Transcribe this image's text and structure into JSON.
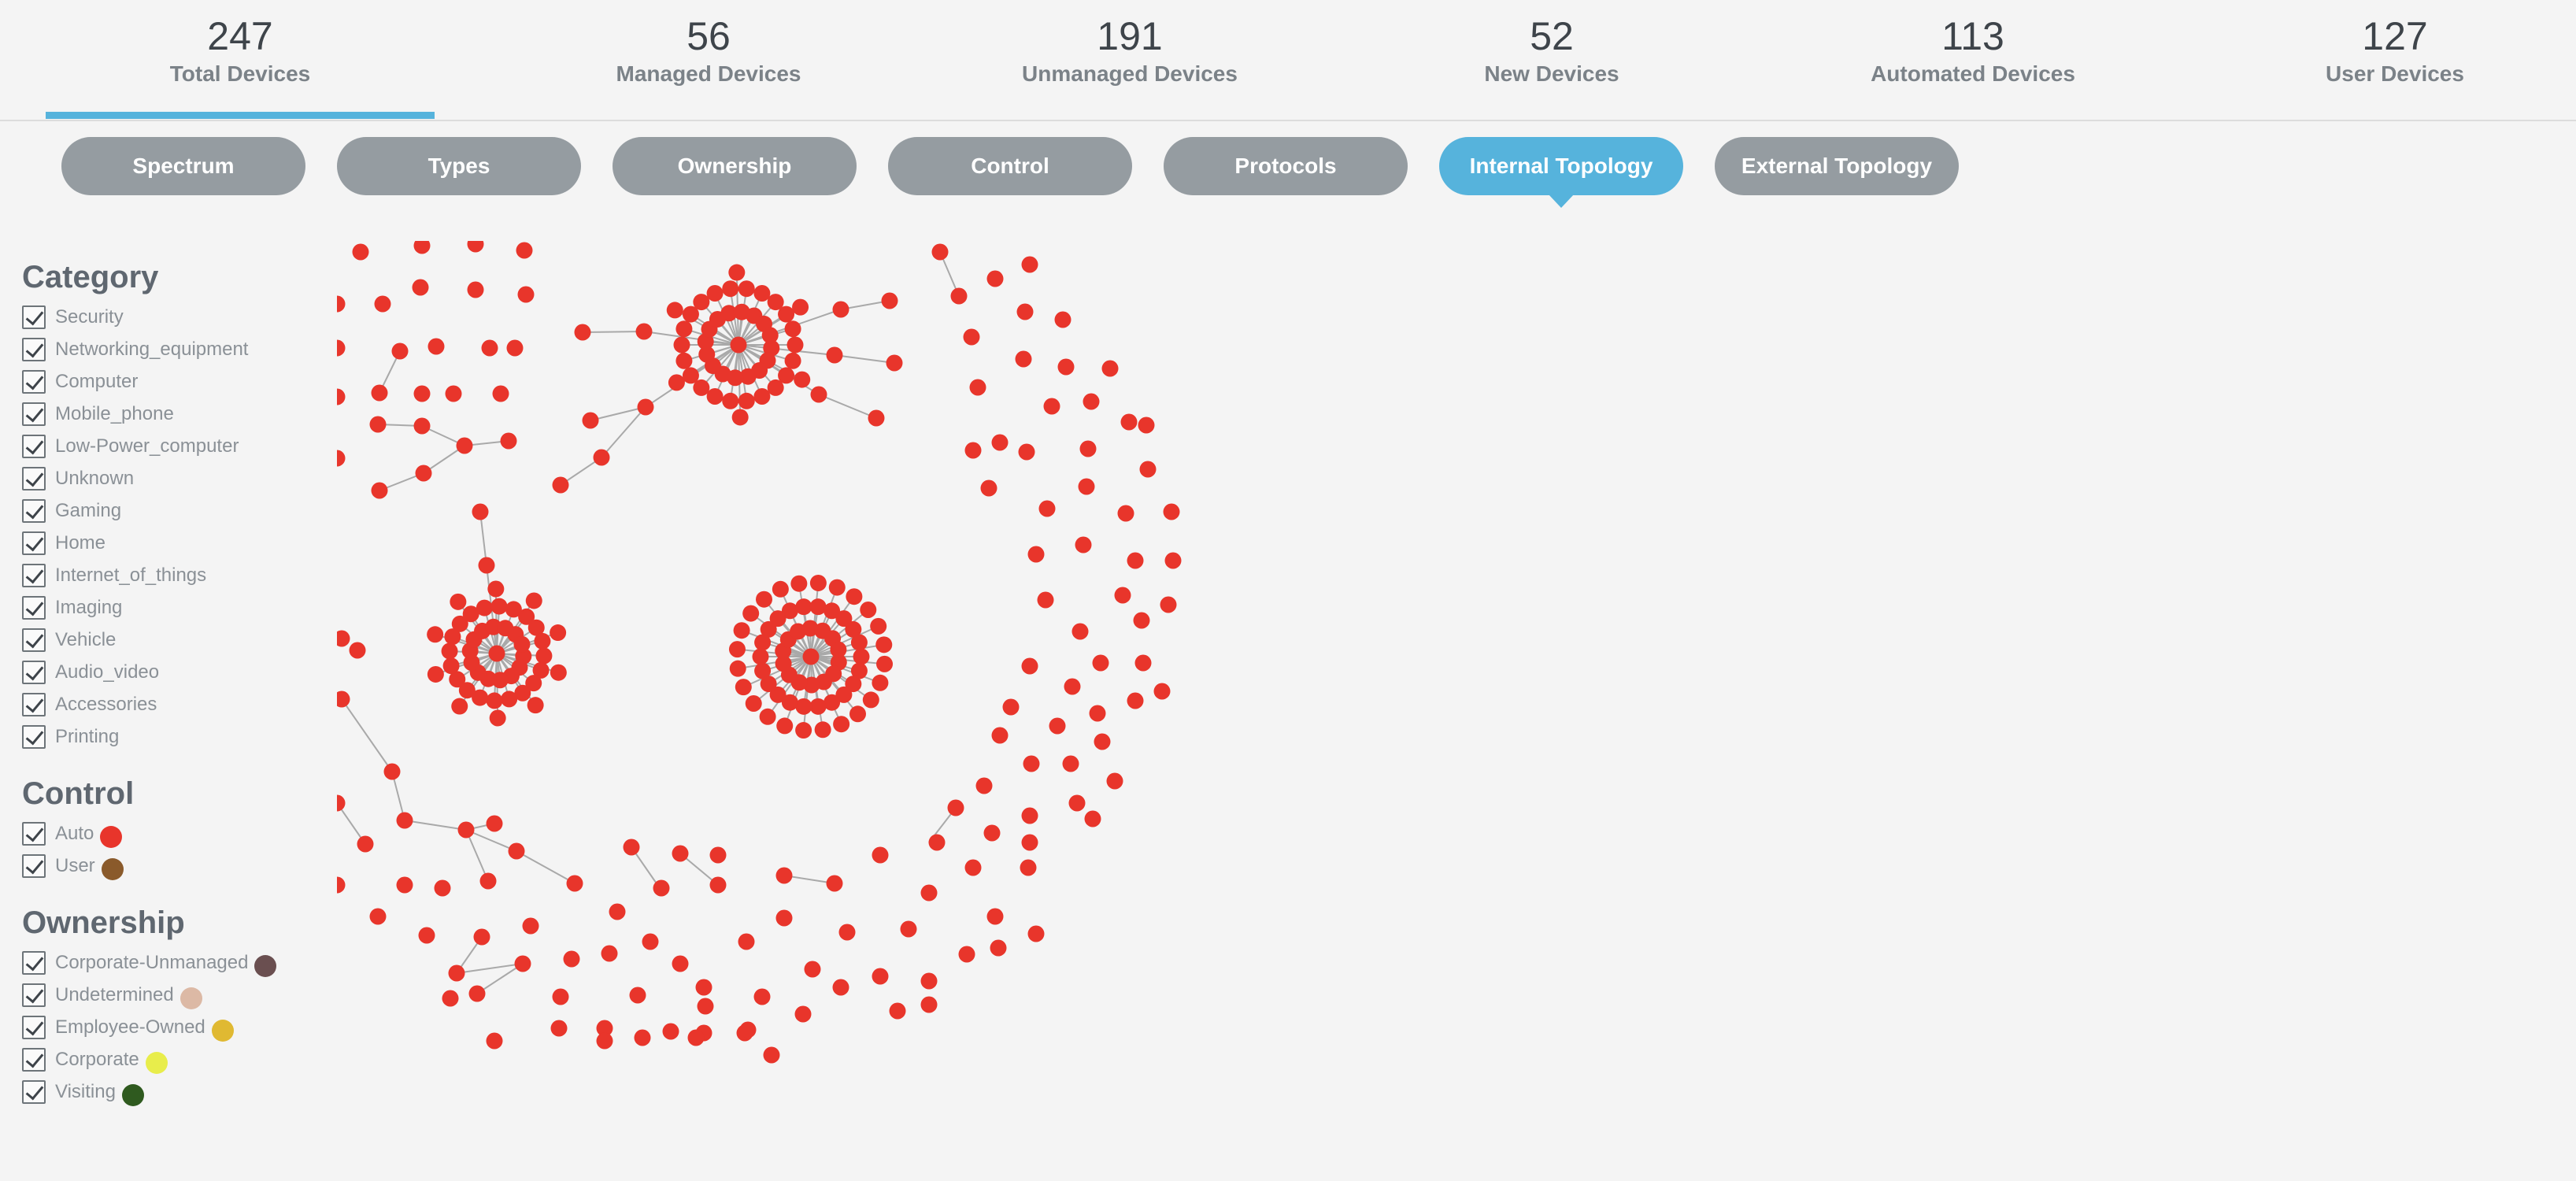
{
  "stats": [
    {
      "value": "247",
      "label": "Total Devices"
    },
    {
      "value": "56",
      "label": "Managed Devices"
    },
    {
      "value": "191",
      "label": "Unmanaged Devices"
    },
    {
      "value": "52",
      "label": "New Devices"
    },
    {
      "value": "113",
      "label": "Automated Devices"
    },
    {
      "value": "127",
      "label": "User Devices"
    }
  ],
  "active_stat": "Total Devices",
  "tabs": [
    "Spectrum",
    "Types",
    "Ownership",
    "Control",
    "Protocols",
    "Internal Topology",
    "External Topology"
  ],
  "active_tab": "Internal Topology",
  "legend": {
    "category": {
      "title": "Category",
      "items": [
        "Security",
        "Networking_equipment",
        "Computer",
        "Mobile_phone",
        "Low-Power_computer",
        "Unknown",
        "Gaming",
        "Home",
        "Internet_of_things",
        "Imaging",
        "Vehicle",
        "Audio_video",
        "Accessories",
        "Printing"
      ]
    },
    "control": {
      "title": "Control",
      "items": [
        {
          "label": "Auto",
          "color": "#e8352b"
        },
        {
          "label": "User",
          "color": "#8a5a2b"
        }
      ]
    },
    "ownership": {
      "title": "Ownership",
      "items": [
        {
          "label": "Corporate-Unmanaged",
          "color": "#6a4f50"
        },
        {
          "label": "Undetermined",
          "color": "#dcb9a5"
        },
        {
          "label": "Employee-Owned",
          "color": "#e0b932"
        },
        {
          "label": "Corporate",
          "color": "#e8ed4b"
        },
        {
          "label": "Visiting",
          "color": "#2f5a1f"
        }
      ]
    }
  },
  "colors": {
    "accent": "#56b3dc",
    "tab_inactive": "#959ca1",
    "node": "#e8352b",
    "edge": "#a9a9a9"
  }
}
